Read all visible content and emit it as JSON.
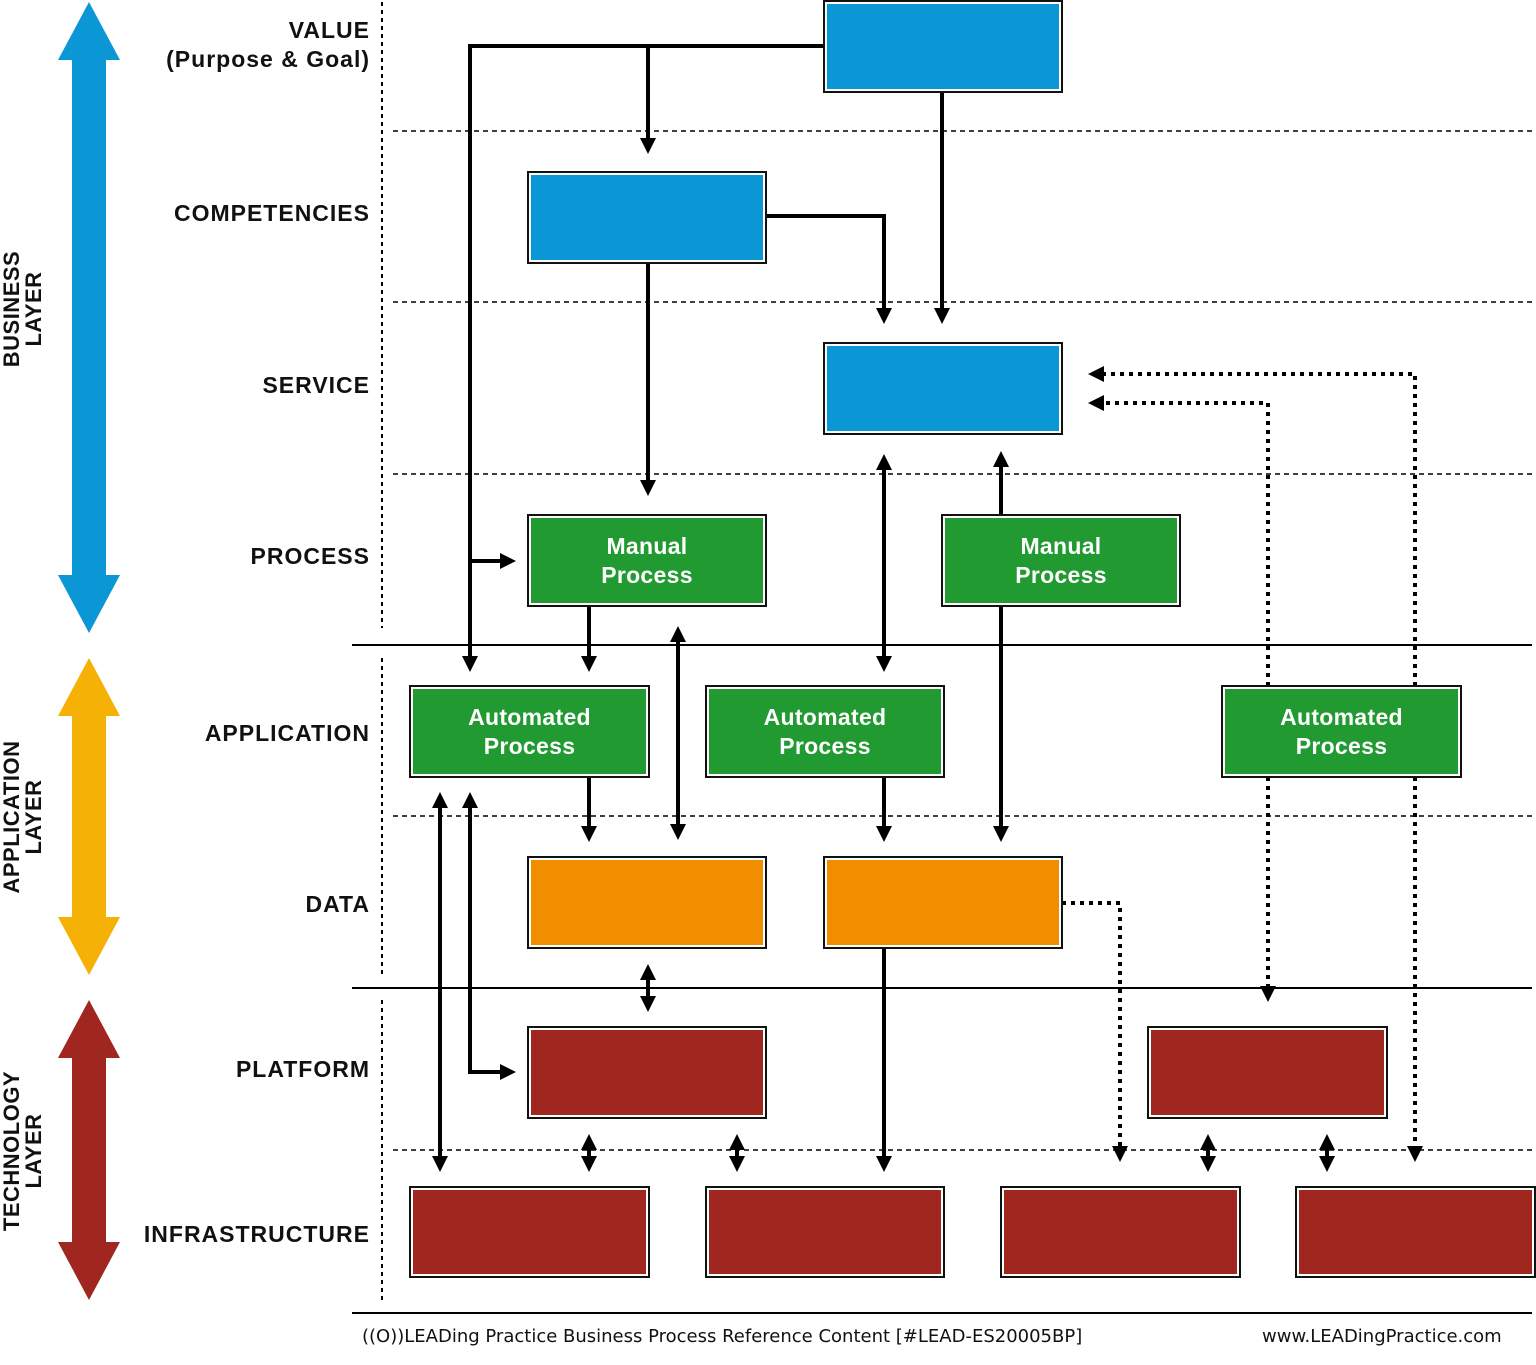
{
  "colors": {
    "business": "#0b97d5",
    "application": "#f5b105",
    "technology": "#a02720",
    "process_green": "#219a32",
    "data_orange": "#f08e00",
    "tech_red": "#a02720",
    "line": "#000000"
  },
  "layers": [
    {
      "id": "business",
      "label_line1": "BUSINESS",
      "label_line2": "LAYER"
    },
    {
      "id": "application",
      "label_line1": "APPLICATION",
      "label_line2": "LAYER"
    },
    {
      "id": "technology",
      "label_line1": "TECHNOLOGY",
      "label_line2": "LAYER"
    }
  ],
  "rows": [
    {
      "id": "value",
      "label": "VALUE",
      "sublabel": "(Purpose & Goal)"
    },
    {
      "id": "competencies",
      "label": "COMPETENCIES"
    },
    {
      "id": "service",
      "label": "SERVICE"
    },
    {
      "id": "process",
      "label": "PROCESS"
    },
    {
      "id": "application",
      "label": "APPLICATION"
    },
    {
      "id": "data",
      "label": "DATA"
    },
    {
      "id": "platform",
      "label": "PLATFORM"
    },
    {
      "id": "infrastructure",
      "label": "INFRASTRUCTURE"
    }
  ],
  "boxes": {
    "value_box": {
      "line1": "",
      "line2": ""
    },
    "competency_box": {
      "line1": "",
      "line2": ""
    },
    "service_box": {
      "line1": "",
      "line2": ""
    },
    "manual_process_1": {
      "line1": "Manual",
      "line2": "Process"
    },
    "manual_process_2": {
      "line1": "Manual",
      "line2": "Process"
    },
    "automated_process_1": {
      "line1": "Automated",
      "line2": "Process"
    },
    "automated_process_2": {
      "line1": "Automated",
      "line2": "Process"
    },
    "automated_process_3": {
      "line1": "Automated",
      "line2": "Process"
    },
    "data_box_1": {
      "line1": "",
      "line2": ""
    },
    "data_box_2": {
      "line1": "",
      "line2": ""
    },
    "platform_box_1": {
      "line1": "",
      "line2": ""
    },
    "platform_box_2": {
      "line1": "",
      "line2": ""
    },
    "infrastructure_box_1": {
      "line1": "",
      "line2": ""
    },
    "infrastructure_box_2": {
      "line1": "",
      "line2": ""
    },
    "infrastructure_box_3": {
      "line1": "",
      "line2": ""
    },
    "infrastructure_box_4": {
      "line1": "",
      "line2": ""
    }
  },
  "footer": {
    "reference": "((O))LEADing Practice Business Process Reference Content [#LEAD-ES20005BP]",
    "website": "www.LEADingPractice.com"
  }
}
